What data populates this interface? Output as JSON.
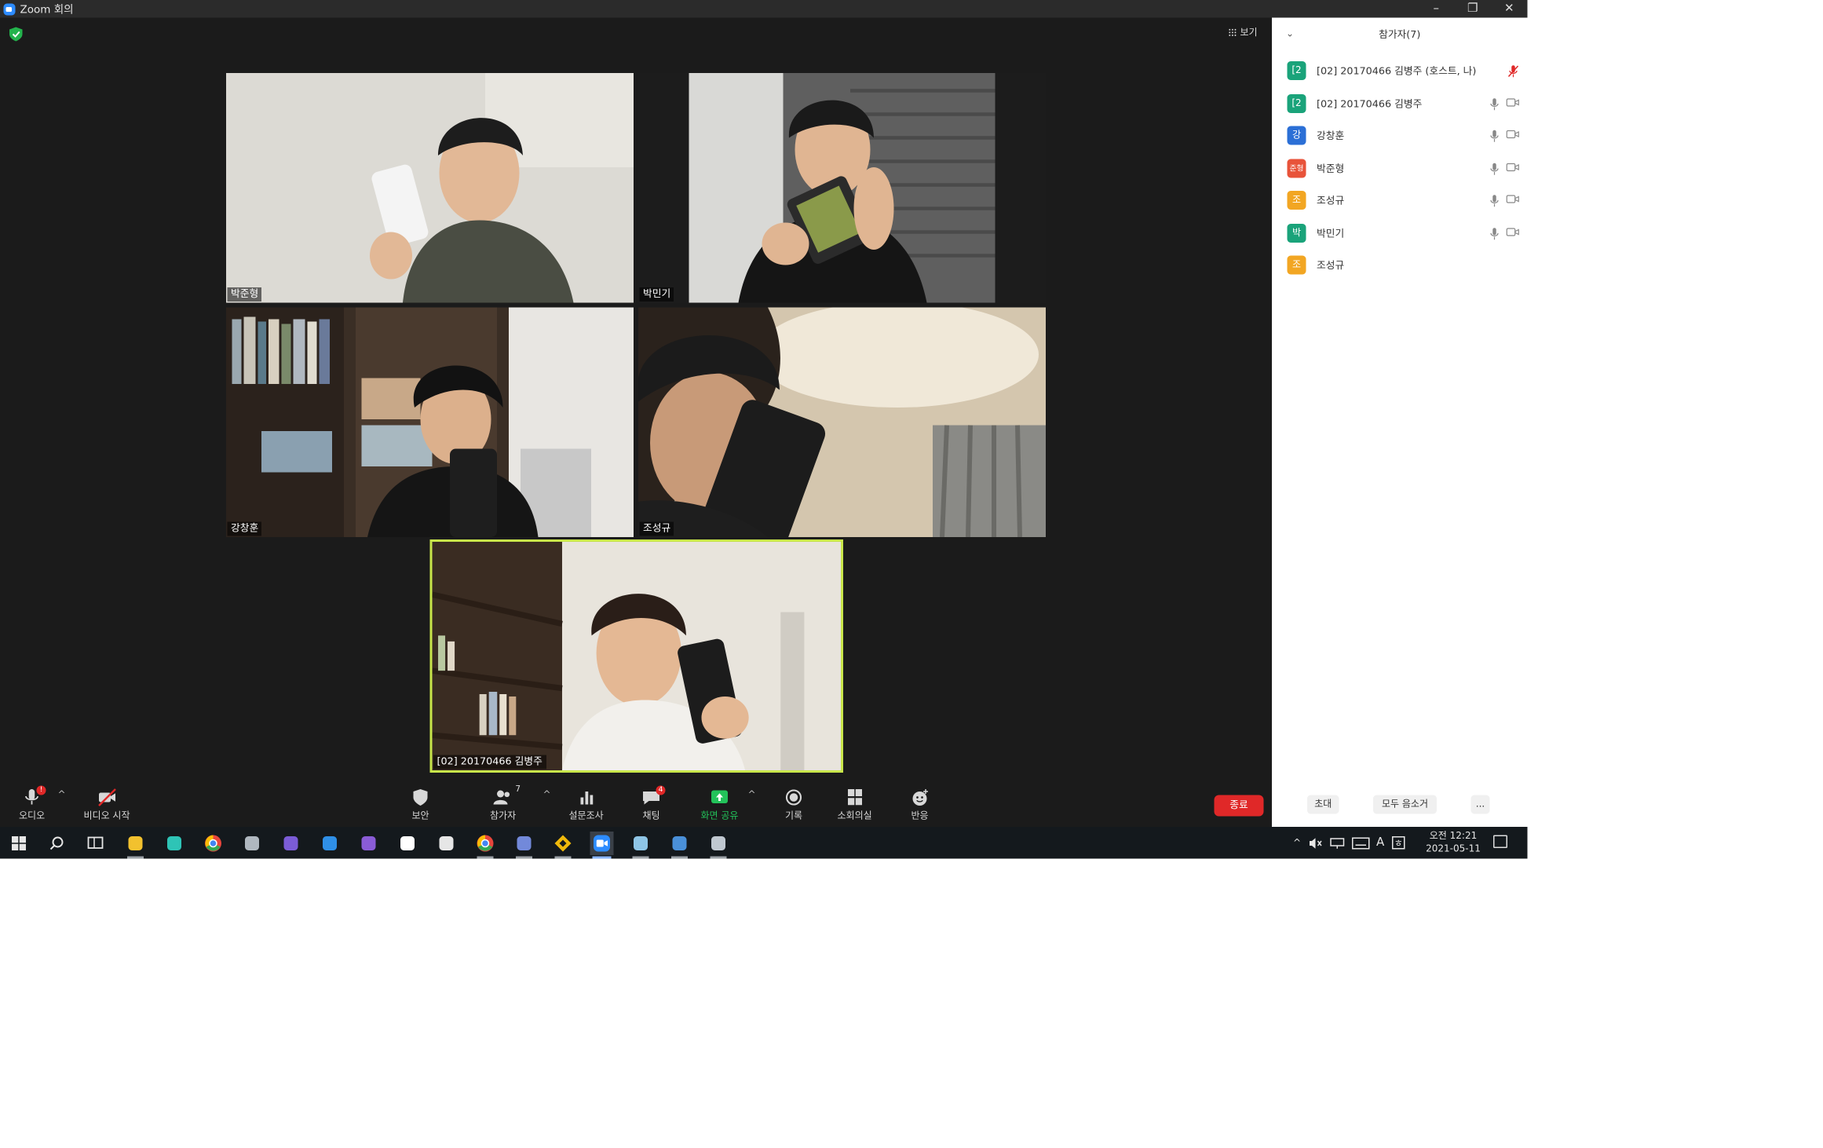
{
  "window": {
    "title": "Zoom 회의",
    "minimize": "–",
    "restore": "❐",
    "close": "✕"
  },
  "meeting": {
    "view_label": "보기",
    "tiles": [
      {
        "name": "박준형"
      },
      {
        "name": "박민기"
      },
      {
        "name": "강창훈"
      },
      {
        "name": "조성규"
      },
      {
        "name": "[02] 20170466 김병주"
      }
    ]
  },
  "toolbar": {
    "audio": {
      "label": "오디오",
      "badge": "!"
    },
    "video": {
      "label": "비디오 시작"
    },
    "security": {
      "label": "보안"
    },
    "participants": {
      "label": "참가자",
      "count": "7"
    },
    "poll": {
      "label": "설문조사"
    },
    "chat": {
      "label": "채팅",
      "badge": "4"
    },
    "share": {
      "label": "화면 공유"
    },
    "record": {
      "label": "기록"
    },
    "breakout": {
      "label": "소회의실"
    },
    "reactions": {
      "label": "반응"
    },
    "end": "종료",
    "caret": "^"
  },
  "participants_panel": {
    "title": "참가자(7)",
    "collapse": "⌄",
    "participants": [
      {
        "avatar": "[2",
        "name": "[02] 20170466 김병주 (호스트, 나)",
        "color": "#1aa37a",
        "mic": "muted-red",
        "cam": false
      },
      {
        "avatar": "[2",
        "name": "[02] 20170466 김병주",
        "color": "#1aa37a",
        "mic": "on",
        "cam": true
      },
      {
        "avatar": "강",
        "name": "강창훈",
        "color": "#2b6fd6",
        "mic": "on",
        "cam": true
      },
      {
        "avatar": "준형",
        "name": "박준형",
        "color": "#e8533a",
        "mic": "on",
        "cam": true
      },
      {
        "avatar": "조",
        "name": "조성규",
        "color": "#f2a623",
        "mic": "on",
        "cam": true
      },
      {
        "avatar": "박",
        "name": "박민기",
        "color": "#1aa37a",
        "mic": "on",
        "cam": true
      },
      {
        "avatar": "조",
        "name": "조성규",
        "color": "#f2a623",
        "mic": "none",
        "cam": false
      }
    ],
    "invite": "초대",
    "mute_all": "모두 음소거",
    "more": "..."
  },
  "taskbar": {
    "clock_line1": "오전 12:21",
    "clock_line2": "2021-05-11",
    "ime": "A",
    "tray_chevron": "^",
    "apps": [
      "windows-start",
      "search",
      "task-view",
      "file-explorer",
      "app-butterfly",
      "chrome",
      "app-gray",
      "github-desktop",
      "vscode",
      "visual-studio",
      "app-blue-circle",
      "app-dark",
      "chrome-2",
      "discord",
      "binance",
      "zoom",
      "app-notes",
      "app-paint",
      "app-chrome-canary"
    ]
  }
}
